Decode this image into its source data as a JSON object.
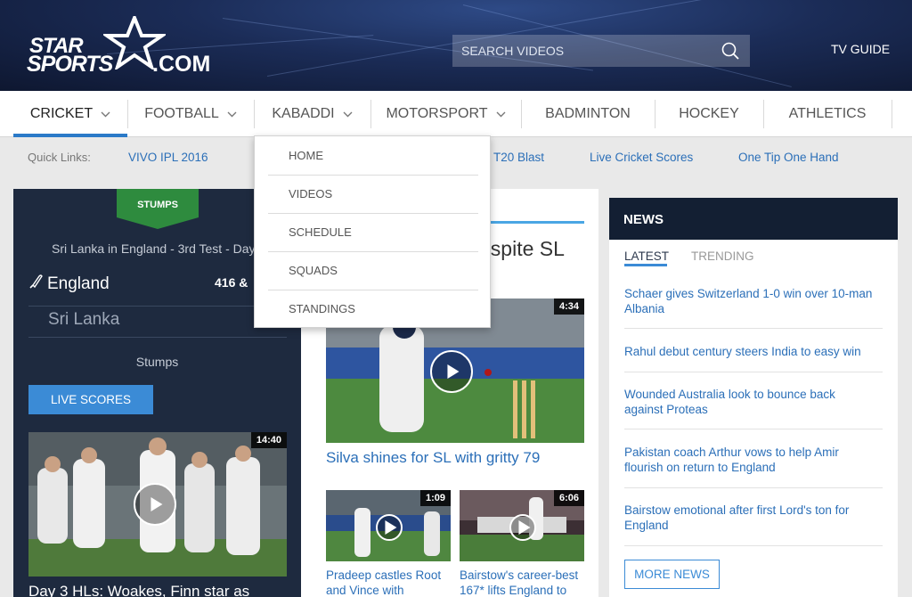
{
  "header": {
    "logo": {
      "line1": "STAR",
      "line2": "SPORTS",
      "line3": ".COM"
    },
    "search": {
      "placeholder": "SEARCH VIDEOS"
    },
    "tv_guide": "TV GUIDE"
  },
  "sport_nav": {
    "items": [
      {
        "label": "CRICKET",
        "has_menu": true,
        "active": true
      },
      {
        "label": "FOOTBALL",
        "has_menu": true
      },
      {
        "label": "KABADDI",
        "has_menu": true
      },
      {
        "label": "MOTORSPORT",
        "has_menu": true
      },
      {
        "label": "BADMINTON"
      },
      {
        "label": "HOCKEY"
      },
      {
        "label": "ATHLETICS"
      }
    ]
  },
  "kabaddi_menu": {
    "items": [
      "HOME",
      "VIDEOS",
      "SCHEDULE",
      "SQUADS",
      "STANDINGS"
    ]
  },
  "quick_links": {
    "label": "Quick Links:",
    "links": [
      "VIVO IPL 2016",
      "T20 Blast",
      "Live Cricket Scores",
      "One Tip One Hand"
    ]
  },
  "score_card": {
    "badge": "STUMPS",
    "match_title": "Sri Lanka in England - 3rd Test - Day",
    "team1": {
      "name": "England",
      "score": "416 &"
    },
    "team2": {
      "name": "Sri Lanka"
    },
    "status": "Stumps",
    "live_scores_label": "LIVE SCORES",
    "video": {
      "duration": "14:40",
      "caption": "Day 3 HLs: Woakes, Finn star as"
    }
  },
  "center": {
    "headline": "espite SL",
    "main_video": {
      "duration": "4:34",
      "caption": "Silva shines for SL with gritty 79"
    },
    "small_videos": [
      {
        "duration": "1:09",
        "caption_line1": "Pradeep castles Root",
        "caption_line2": "and Vince with"
      },
      {
        "duration": "6:06",
        "caption_line1": "Bairstow's career-best",
        "caption_line2": "167* lifts England to"
      }
    ]
  },
  "news": {
    "title": "NEWS",
    "tabs": [
      "LATEST",
      "TRENDING"
    ],
    "items": [
      {
        "line1": "Schaer gives Switzerland 1-0 win over 10-man",
        "line2": "Albania"
      },
      {
        "line1": "Rahul debut century steers India to easy win",
        "line2": ""
      },
      {
        "line1": "Wounded Australia look to bounce back",
        "line2": "against Proteas"
      },
      {
        "line1": "Pakistan coach Arthur vows to help Amir",
        "line2": "flourish on return to England"
      },
      {
        "line1": "Bairstow emotional after first Lord's ton for",
        "line2": "England"
      }
    ],
    "more_label": "MORE NEWS"
  },
  "colors": {
    "header_bg": "#1b2c57",
    "accent_blue": "#2b7ac8",
    "link_blue": "#2b6fb8",
    "score_panel_bg": "#1e2a3f",
    "stumps_green": "#2e8b3e",
    "news_header_bg": "#131f33"
  }
}
